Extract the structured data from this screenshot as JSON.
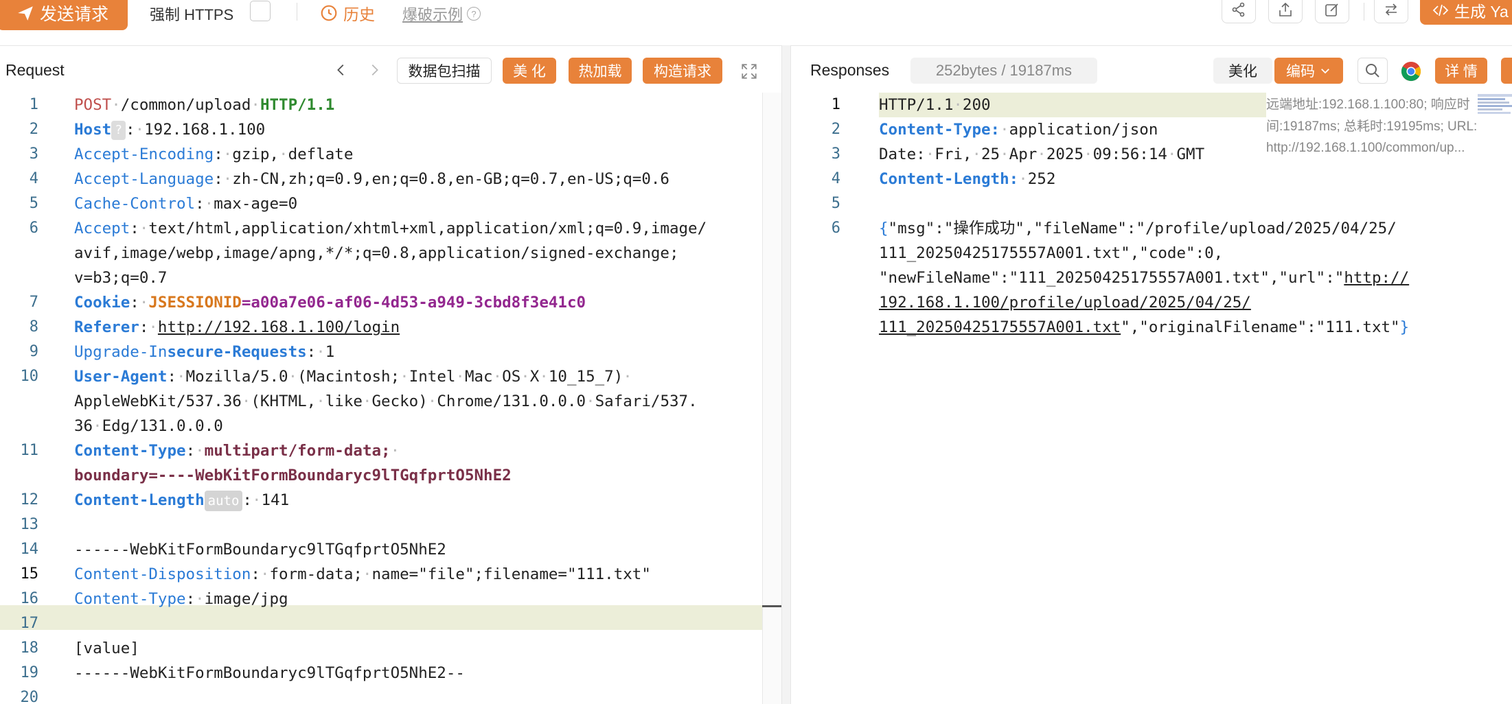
{
  "toolbar": {
    "send_label": "发送请求",
    "force_https_label": "强制 HTTPS",
    "history_label": "历史",
    "burst_example_label": "爆破示例",
    "generate_label": "生成 Ya"
  },
  "request": {
    "title": "Request",
    "scan_label": "数据包扫描",
    "beautify_label": "美 化",
    "hotload_label": "热加载",
    "construct_label": "构造请求",
    "line_numbers": [
      "1",
      "2",
      "3",
      "4",
      "5",
      "6",
      "7",
      "8",
      "9",
      "10",
      "11",
      "12",
      "13",
      "14",
      "15",
      "16",
      "17",
      "18",
      "19",
      "20"
    ],
    "lines": {
      "l1_method": "POST",
      "l1_path": "/common/upload",
      "l1_proto": "HTTP/1.1",
      "l2_key": "Host",
      "l2_tag": "?",
      "l2_val": "192.168.1.100",
      "l3_key": "Accept-Encoding",
      "l3_val": "gzip,",
      "l3_val2": "deflate",
      "l4_key": "Accept-Language",
      "l4_val": "zh-CN,zh;q=0.9,en;q=0.8,en-GB;q=0.7,en-US;q=0.6",
      "l5_key": "Cache-Control",
      "l5_val": "max-age=0",
      "l6_key": "Accept",
      "l6_val": "text/html,application/xhtml+xml,application/xml;q=0.9,image/",
      "l6_cont1": "avif,image/webp,image/apng,*/*;q=0.8,application/signed-exchange;",
      "l6_cont2": "v=b3;q=0.7",
      "l7_key": "Cookie",
      "l7_name": "JSESSIONID",
      "l7_val": "a00a7e06-af06-4d53-a949-3cbd8f3e41c0",
      "l8_key": "Referer",
      "l8_val": "http://192.168.1.100/login",
      "l9_key_a": "Upgrade-In",
      "l9_key_b": "secure-Requests",
      "l9_val": "1",
      "l10_key": "User-Agent",
      "l10_v1": "Mozilla/5.0",
      "l10_v2": "(Macintosh;",
      "l10_v3": "Intel",
      "l10_v4": "Mac",
      "l10_v5": "OS",
      "l10_v6": "X",
      "l10_v7": "10_15_7)",
      "l10_cont1a": "AppleWebKit/537.36",
      "l10_cont1b": "(KHTML,",
      "l10_cont1c": "like",
      "l10_cont1d": "Gecko)",
      "l10_cont1e": "Chrome/131.0.0.0",
      "l10_cont1f": "Safari/537.",
      "l10_cont2a": "36",
      "l10_cont2b": "Edg/131.0.0.0",
      "l11_key": "Content-Type",
      "l11_val": "multipart/form-data;",
      "l11_cont": "boundary=----WebKitFormBoundaryc9lTGqfprtO5NhE2",
      "l12_key": "Content-Length",
      "l12_tag": "auto",
      "l12_val": "141",
      "l14": "------WebKitFormBoundaryc9lTGqfprtO5NhE2",
      "l15_key": "Content-Disposition",
      "l15_v1": "form-data;",
      "l15_v2": "name=\"file\";filename=\"111.txt\"",
      "l16_key": "Content-Type",
      "l16_val": "image/jpg",
      "l18": "[value]",
      "l19": "------WebKitFormBoundaryc9lTGqfprtO5NhE2--"
    }
  },
  "response": {
    "title": "Responses",
    "size_badge": "252bytes / 19187ms",
    "beautify_label": "美化",
    "encode_label": "编码",
    "detail_label": "详 情",
    "meta_info": "远端地址:192.168.1.100:80; 响应时间:19187ms; 总耗时:19195ms; URL:http://192.168.1.100/common/up...",
    "line_numbers": [
      "1",
      "2",
      "3",
      "4",
      "5",
      "6"
    ],
    "lines": {
      "r1a": "HTTP/1.1",
      "r1b": "200",
      "r2_key": "Content-Type:",
      "r2_val": "application/json",
      "r3_key": "Date:",
      "r3_v1": "Fri,",
      "r3_v2": "25",
      "r3_v3": "Apr",
      "r3_v4": "2025",
      "r3_v5": "09:56:14",
      "r3_v6": "GMT",
      "r4_key": "Content-Length:",
      "r4_val": "252",
      "r6_open": "{",
      "r6_a": "\"msg\":\"操作成功\",\"fileName\":\"/profile/upload/2025/04/25/",
      "r6_b": "111_20250425175557A001.txt\",\"code\":0,",
      "r6_c1": "\"newFileName\":\"111_20250425175557A001.txt\",\"url\":\"",
      "r6_c2": "http://",
      "r6_d": "192.168.1.100/profile/upload/2025/04/25/",
      "r6_e1": "111_20250425175557A001.txt",
      "r6_e2": "\",\"originalFilename\":\"111.txt\"",
      "r6_close": "}"
    }
  },
  "colors": {
    "accent": "#e8823a",
    "highlight_line": "#eceed9",
    "keyword_blue": "#2b7bd6",
    "method_red": "#c0504d",
    "proto_green": "#2f8a2f"
  }
}
